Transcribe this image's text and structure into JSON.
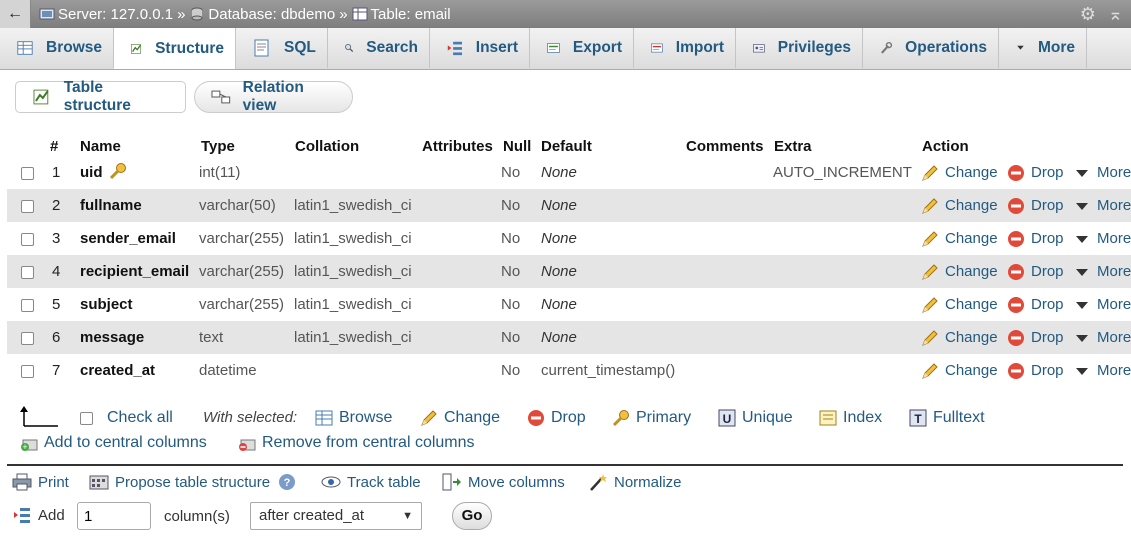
{
  "breadcrumb": {
    "back": "←",
    "server": "Server: 127.0.0.1",
    "database": "Database: dbdemo",
    "table": "Table: email",
    "sep": "»"
  },
  "tabs": [
    {
      "label": "Browse",
      "icon": "browse-icon"
    },
    {
      "label": "Structure",
      "icon": "structure-icon",
      "active": true
    },
    {
      "label": "SQL",
      "icon": "sql-icon"
    },
    {
      "label": "Search",
      "icon": "search-icon"
    },
    {
      "label": "Insert",
      "icon": "insert-icon"
    },
    {
      "label": "Export",
      "icon": "export-icon"
    },
    {
      "label": "Import",
      "icon": "import-icon"
    },
    {
      "label": "Privileges",
      "icon": "privileges-icon"
    },
    {
      "label": "Operations",
      "icon": "operations-icon"
    },
    {
      "label": "More",
      "icon": "chevron-down-icon"
    }
  ],
  "subtabs": {
    "table_structure": "Table structure",
    "relation_view": "Relation view"
  },
  "columns": {
    "num": "#",
    "name": "Name",
    "type": "Type",
    "collation": "Collation",
    "attributes": "Attributes",
    "null": "Null",
    "default": "Default",
    "comments": "Comments",
    "extra": "Extra",
    "action": "Action"
  },
  "rows": [
    {
      "num": "1",
      "name": "uid",
      "type": "int(11)",
      "collation": "",
      "null": "No",
      "default": "None",
      "extra": "AUTO_INCREMENT",
      "primary": true
    },
    {
      "num": "2",
      "name": "fullname",
      "type": "varchar(50)",
      "collation": "latin1_swedish_ci",
      "null": "No",
      "default": "None",
      "extra": ""
    },
    {
      "num": "3",
      "name": "sender_email",
      "type": "varchar(255)",
      "collation": "latin1_swedish_ci",
      "null": "No",
      "default": "None",
      "extra": ""
    },
    {
      "num": "4",
      "name": "recipient_email",
      "type": "varchar(255)",
      "collation": "latin1_swedish_ci",
      "null": "No",
      "default": "None",
      "extra": ""
    },
    {
      "num": "5",
      "name": "subject",
      "type": "varchar(255)",
      "collation": "latin1_swedish_ci",
      "null": "No",
      "default": "None",
      "extra": ""
    },
    {
      "num": "6",
      "name": "message",
      "type": "text",
      "collation": "latin1_swedish_ci",
      "null": "No",
      "default": "None",
      "extra": ""
    },
    {
      "num": "7",
      "name": "created_at",
      "type": "datetime",
      "collation": "",
      "null": "No",
      "default": "current_timestamp()",
      "extra": ""
    }
  ],
  "actions": {
    "change": "Change",
    "drop": "Drop",
    "more": "More"
  },
  "with_selected": {
    "check_all": "Check all",
    "label": "With selected:",
    "browse": "Browse",
    "change": "Change",
    "drop": "Drop",
    "primary": "Primary",
    "unique": "Unique",
    "index": "Index",
    "fulltext": "Fulltext",
    "add_central": "Add to central columns",
    "remove_central": "Remove from central columns"
  },
  "bottom_links": {
    "print": "Print",
    "propose": "Propose table structure",
    "track": "Track table",
    "move": "Move columns",
    "normalize": "Normalize"
  },
  "add_columns": {
    "add_label": "Add",
    "count": "1",
    "columns_label": "column(s)",
    "position": "after created_at",
    "go": "Go"
  },
  "colors": {
    "link": "#235a81",
    "drop": "#e04a3a",
    "even_row": "#e5e5e5"
  }
}
